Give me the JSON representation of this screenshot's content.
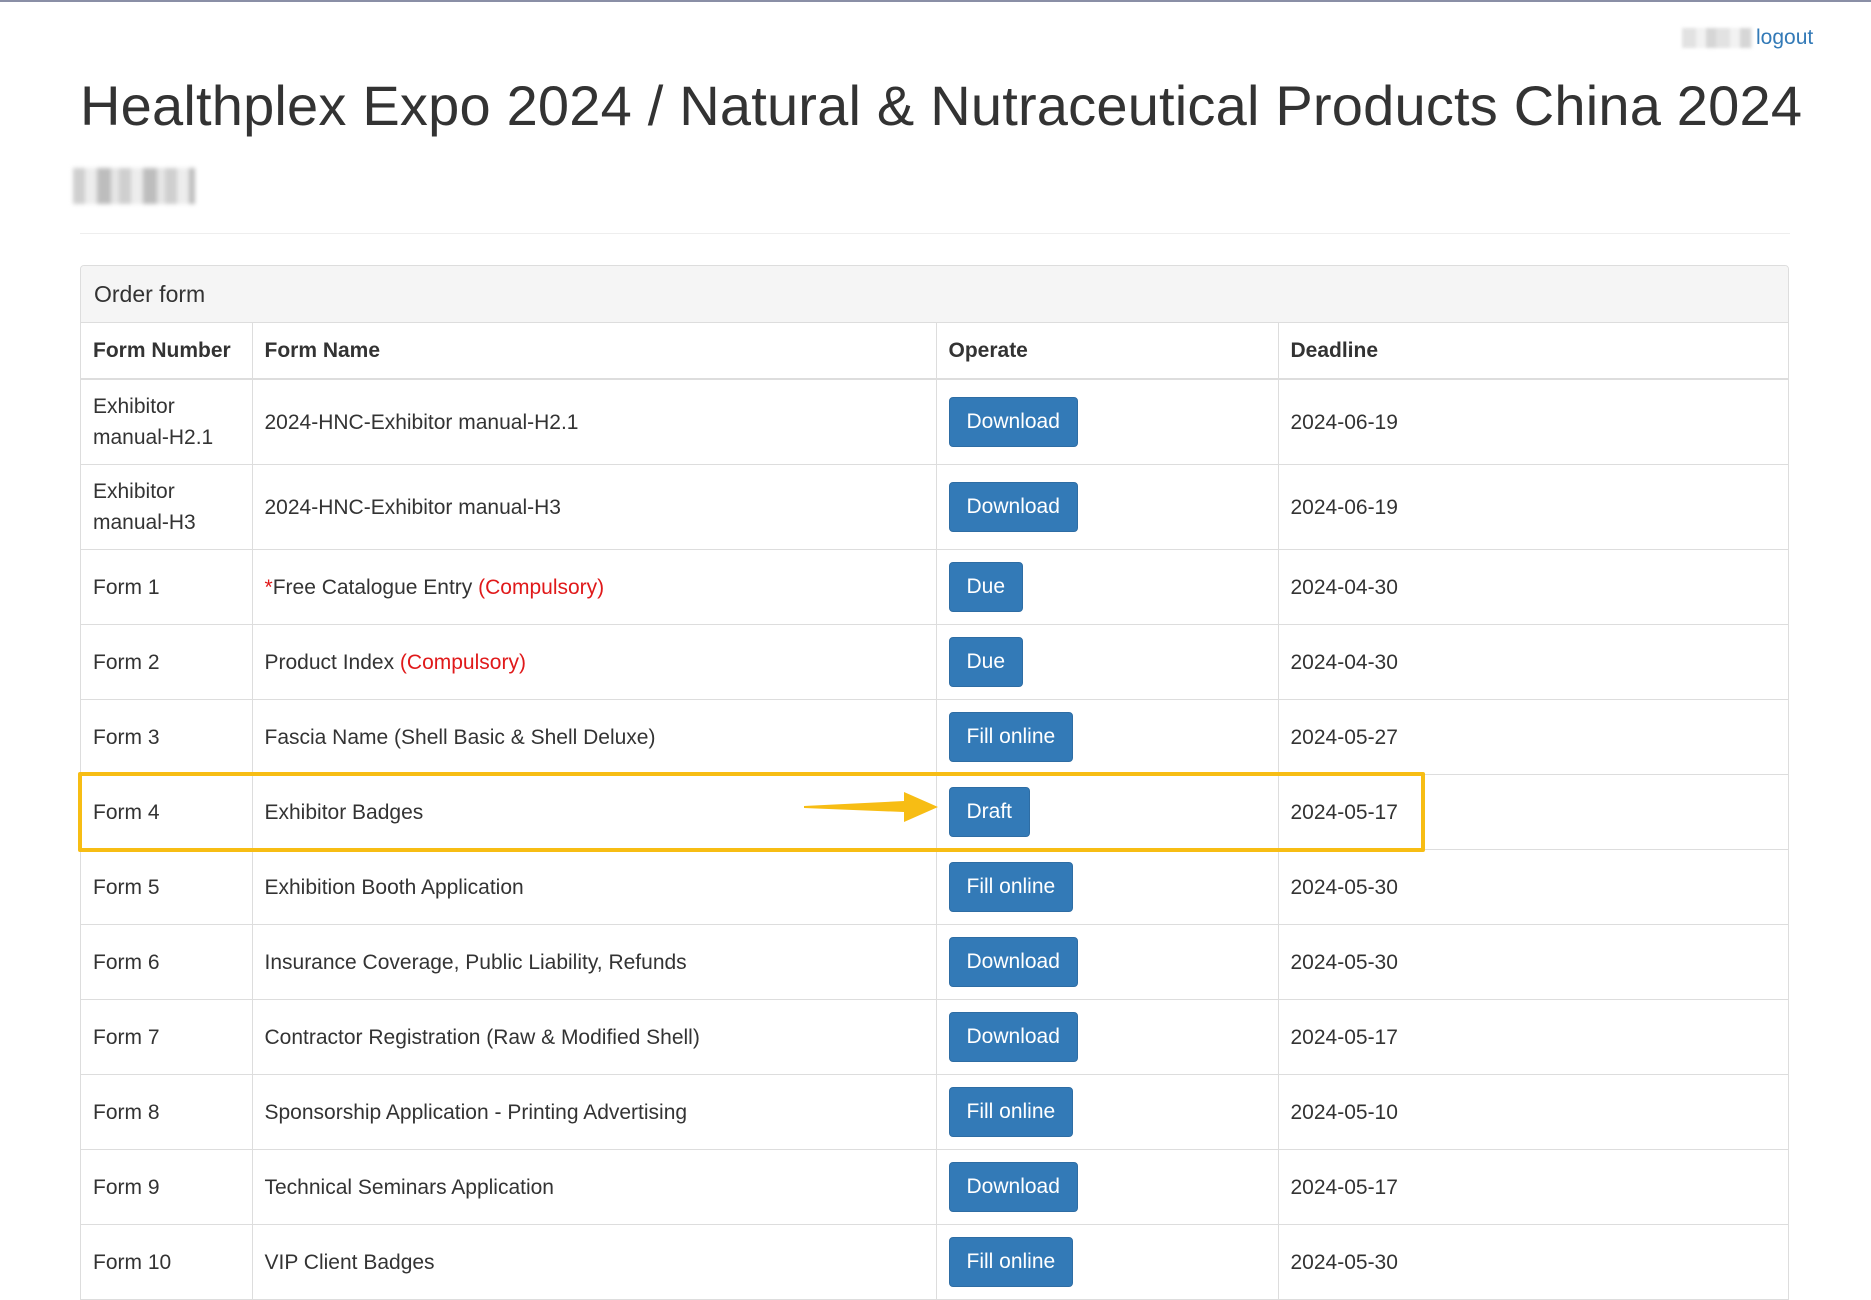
{
  "header": {
    "logout_label": "logout",
    "title": "Healthplex Expo 2024 / Natural & Nutraceutical Products China 2024"
  },
  "panel": {
    "heading": "Order form"
  },
  "table": {
    "columns": [
      "Form Number",
      "Form Name",
      "Operate",
      "Deadline"
    ],
    "rows": [
      {
        "number": "Exhibitor manual-H2.1",
        "name": "2024-HNC-Exhibitor manual-H2.1",
        "name_prefix_star": "",
        "compulsory": "",
        "operate": "Download",
        "deadline": "2024-06-19"
      },
      {
        "number": "Exhibitor manual-H3",
        "name": "2024-HNC-Exhibitor manual-H3",
        "name_prefix_star": "",
        "compulsory": "",
        "operate": "Download",
        "deadline": "2024-06-19"
      },
      {
        "number": "Form 1",
        "name": "Free Catalogue Entry ",
        "name_prefix_star": "*",
        "compulsory": "(Compulsory)",
        "operate": "Due",
        "deadline": "2024-04-30"
      },
      {
        "number": "Form 2",
        "name": "Product Index ",
        "name_prefix_star": "",
        "compulsory": "(Compulsory)",
        "operate": "Due",
        "deadline": "2024-04-30"
      },
      {
        "number": "Form 3",
        "name": "Fascia Name (Shell Basic & Shell Deluxe)",
        "name_prefix_star": "",
        "compulsory": "",
        "operate": "Fill online",
        "deadline": "2024-05-27"
      },
      {
        "number": "Form 4",
        "name": "Exhibitor Badges",
        "name_prefix_star": "",
        "compulsory": "",
        "operate": "Draft",
        "deadline": "2024-05-17"
      },
      {
        "number": "Form 5",
        "name": "Exhibition Booth Application",
        "name_prefix_star": "",
        "compulsory": "",
        "operate": "Fill online",
        "deadline": "2024-05-30"
      },
      {
        "number": "Form 6",
        "name": "Insurance Coverage, Public Liability, Refunds",
        "name_prefix_star": "",
        "compulsory": "",
        "operate": "Download",
        "deadline": "2024-05-30"
      },
      {
        "number": "Form 7",
        "name": "Contractor Registration (Raw & Modified Shell)",
        "name_prefix_star": "",
        "compulsory": "",
        "operate": "Download",
        "deadline": "2024-05-17"
      },
      {
        "number": "Form 8",
        "name": "Sponsorship Application - Printing Advertising",
        "name_prefix_star": "",
        "compulsory": "",
        "operate": "Fill online",
        "deadline": "2024-05-10"
      },
      {
        "number": "Form 9",
        "name": "Technical Seminars Application",
        "name_prefix_star": "",
        "compulsory": "",
        "operate": "Download",
        "deadline": "2024-05-17"
      },
      {
        "number": "Form 10",
        "name": "VIP Client Badges",
        "name_prefix_star": "",
        "compulsory": "",
        "operate": "Fill online",
        "deadline": "2024-05-30"
      }
    ]
  },
  "colors": {
    "button_primary": "#337ab7",
    "compulsory_text": "#e0191a",
    "highlight": "#f7bd14",
    "link": "#337ab7"
  },
  "annotation": {
    "highlighted_row": "Form 4",
    "arrow_icon": "arrow-right-icon"
  }
}
